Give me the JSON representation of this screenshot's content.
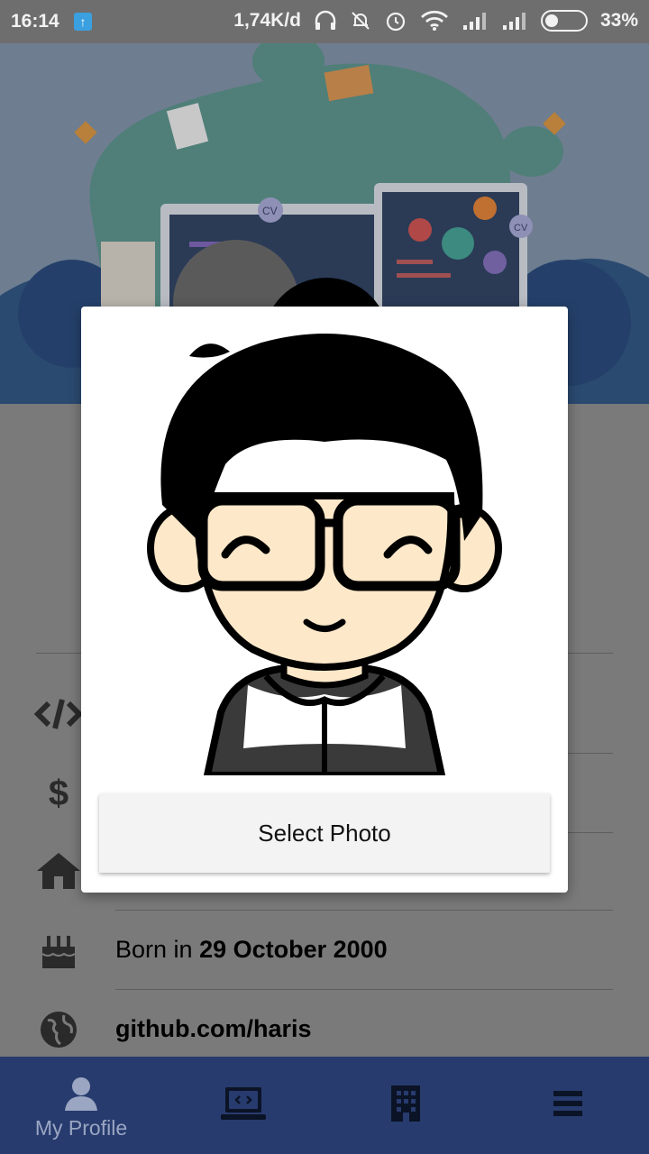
{
  "status_bar": {
    "time": "16:14",
    "speed": "1,74K/d",
    "battery": "33%",
    "battery_level": 0.33
  },
  "profile_rows": [
    {
      "icon": "code-icon",
      "prefix": "",
      "bold": ""
    },
    {
      "icon": "dollar-icon",
      "prefix": "",
      "bold": ""
    },
    {
      "icon": "home-icon",
      "prefix": "",
      "bold": ""
    },
    {
      "icon": "cake-icon",
      "prefix": "Born in ",
      "bold": "29 October 2000"
    },
    {
      "icon": "globe-icon",
      "prefix": "",
      "bold": "github.com/haris"
    }
  ],
  "dialog": {
    "select_label": "Select Photo"
  },
  "bottom_nav": {
    "items": [
      {
        "icon": "user-icon",
        "label": "My Profile",
        "active": true
      },
      {
        "icon": "laptop-code-icon",
        "label": ""
      },
      {
        "icon": "building-icon",
        "label": ""
      },
      {
        "icon": "menu-icon",
        "label": ""
      }
    ]
  },
  "colors": {
    "nav_bg": "#273b6e",
    "dim_background": "#7a7a7a",
    "status_bar": "#6e6e6e"
  }
}
